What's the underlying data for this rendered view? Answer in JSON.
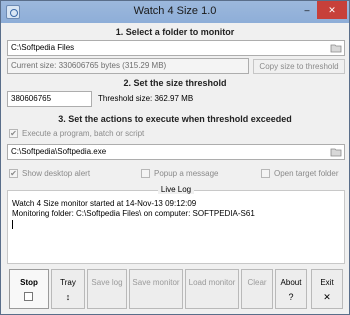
{
  "window": {
    "title": "Watch 4 Size 1.0",
    "minimize": "‒",
    "close": "✕"
  },
  "section1": {
    "title": "1. Select a folder to monitor",
    "folder_value": "C:\\Softpedia Files",
    "current_size": "Current size: 330606765 bytes (315.29 MB)",
    "copy_button": "Copy size to threshold"
  },
  "section2": {
    "title": "2. Set the size threshold",
    "threshold_value": "380606765",
    "threshold_size": "Threshold size: 362.97 MB"
  },
  "section3": {
    "title": "3. Set the actions to execute when threshold exceeded",
    "execute_label": "Execute a program, batch or script",
    "execute_checked": true,
    "program_value": "C:\\Softpedia\\Softpedia.exe",
    "show_alert_label": "Show desktop alert",
    "show_alert_checked": true,
    "popup_label": "Popup a message",
    "popup_checked": false,
    "open_folder_label": "Open target folder",
    "open_folder_checked": false
  },
  "live_log": {
    "title": "Live Log",
    "lines": "Watch 4 Size monitor started at 14-Nov-13 09:12:09\nMonitoring folder: C:\\Softpedia Files\\ on computer: SOFTPEDIA-S61"
  },
  "toolbar": {
    "stop": "Stop",
    "tray": "Tray",
    "tray_icon": "↕",
    "save_log": "Save log",
    "save_monitor": "Save monitor",
    "load_monitor": "Load monitor",
    "clear": "Clear",
    "about": "About",
    "about_icon": "?",
    "exit": "Exit",
    "exit_icon": "✕"
  }
}
